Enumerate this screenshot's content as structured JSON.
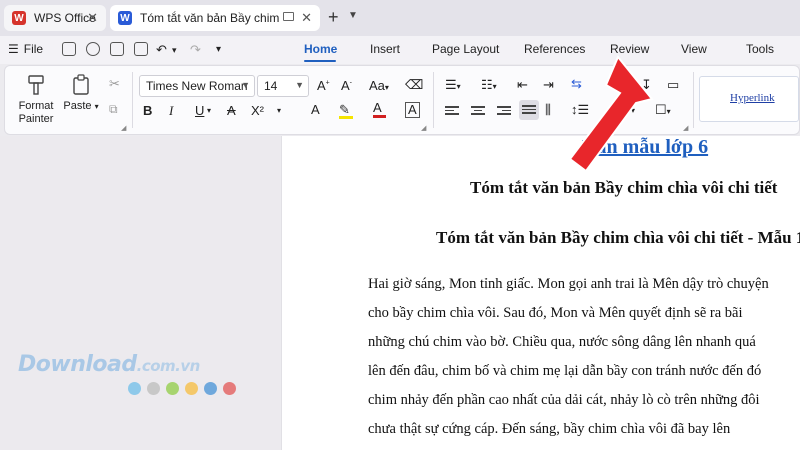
{
  "tabs": {
    "wps_label": "WPS Office",
    "doc_label": "Tóm tắt văn bản Bầy chim chìa vôi",
    "doc_icon_letter": "W"
  },
  "menubar": {
    "file_label": "File",
    "ribbon_tabs": [
      "Home",
      "Insert",
      "Page Layout",
      "References",
      "Review",
      "View",
      "Tools"
    ]
  },
  "ribbon": {
    "format_painter": "Format Painter",
    "paste": "Paste",
    "font_name": "Times New Roman",
    "font_size": "14",
    "style_hyperlink": "Hyperlink",
    "bold": "B",
    "italic": "I",
    "underline": "U",
    "superscript": "X²"
  },
  "document": {
    "link_text": "Văn mẫu lớp 6",
    "title1": "Tóm tắt văn bản Bầy chim chìa vôi chi tiết",
    "title2": "Tóm tắt văn bản Bầy chim chìa vôi chi tiết - Mẫu 1",
    "paragraph_lines": [
      "Hai giờ sáng, Mon tỉnh giấc. Mon gọi anh trai là Mên dậy trò chuyện",
      "cho bầy chim chìa vôi. Sau đó, Mon và Mên quyết định sẽ ra bãi",
      "những chú chim vào bờ. Chiều qua, nước sông dâng lên nhanh quá",
      "lên đến đâu, chim bố và chim mẹ lại dẫn bầy con tránh nước đến đó",
      "chim nhảy đến phần cao nhất của dải cát, nhảy lò cò trên những đôi",
      "chưa thật sự cứng cáp. Đến sáng, bầy chim chìa vôi đã bay lên"
    ]
  },
  "watermark": {
    "brand": "Download",
    "suffix": ".com.vn",
    "dot_colors": [
      "#8ec9ea",
      "#c8c8c8",
      "#a7d46f",
      "#f4c86a",
      "#6fa8dc",
      "#e57b7b"
    ]
  },
  "colors": {
    "accent": "#1f5fbf",
    "arrow": "#e8262b",
    "wps_logo": "#d6342c"
  }
}
